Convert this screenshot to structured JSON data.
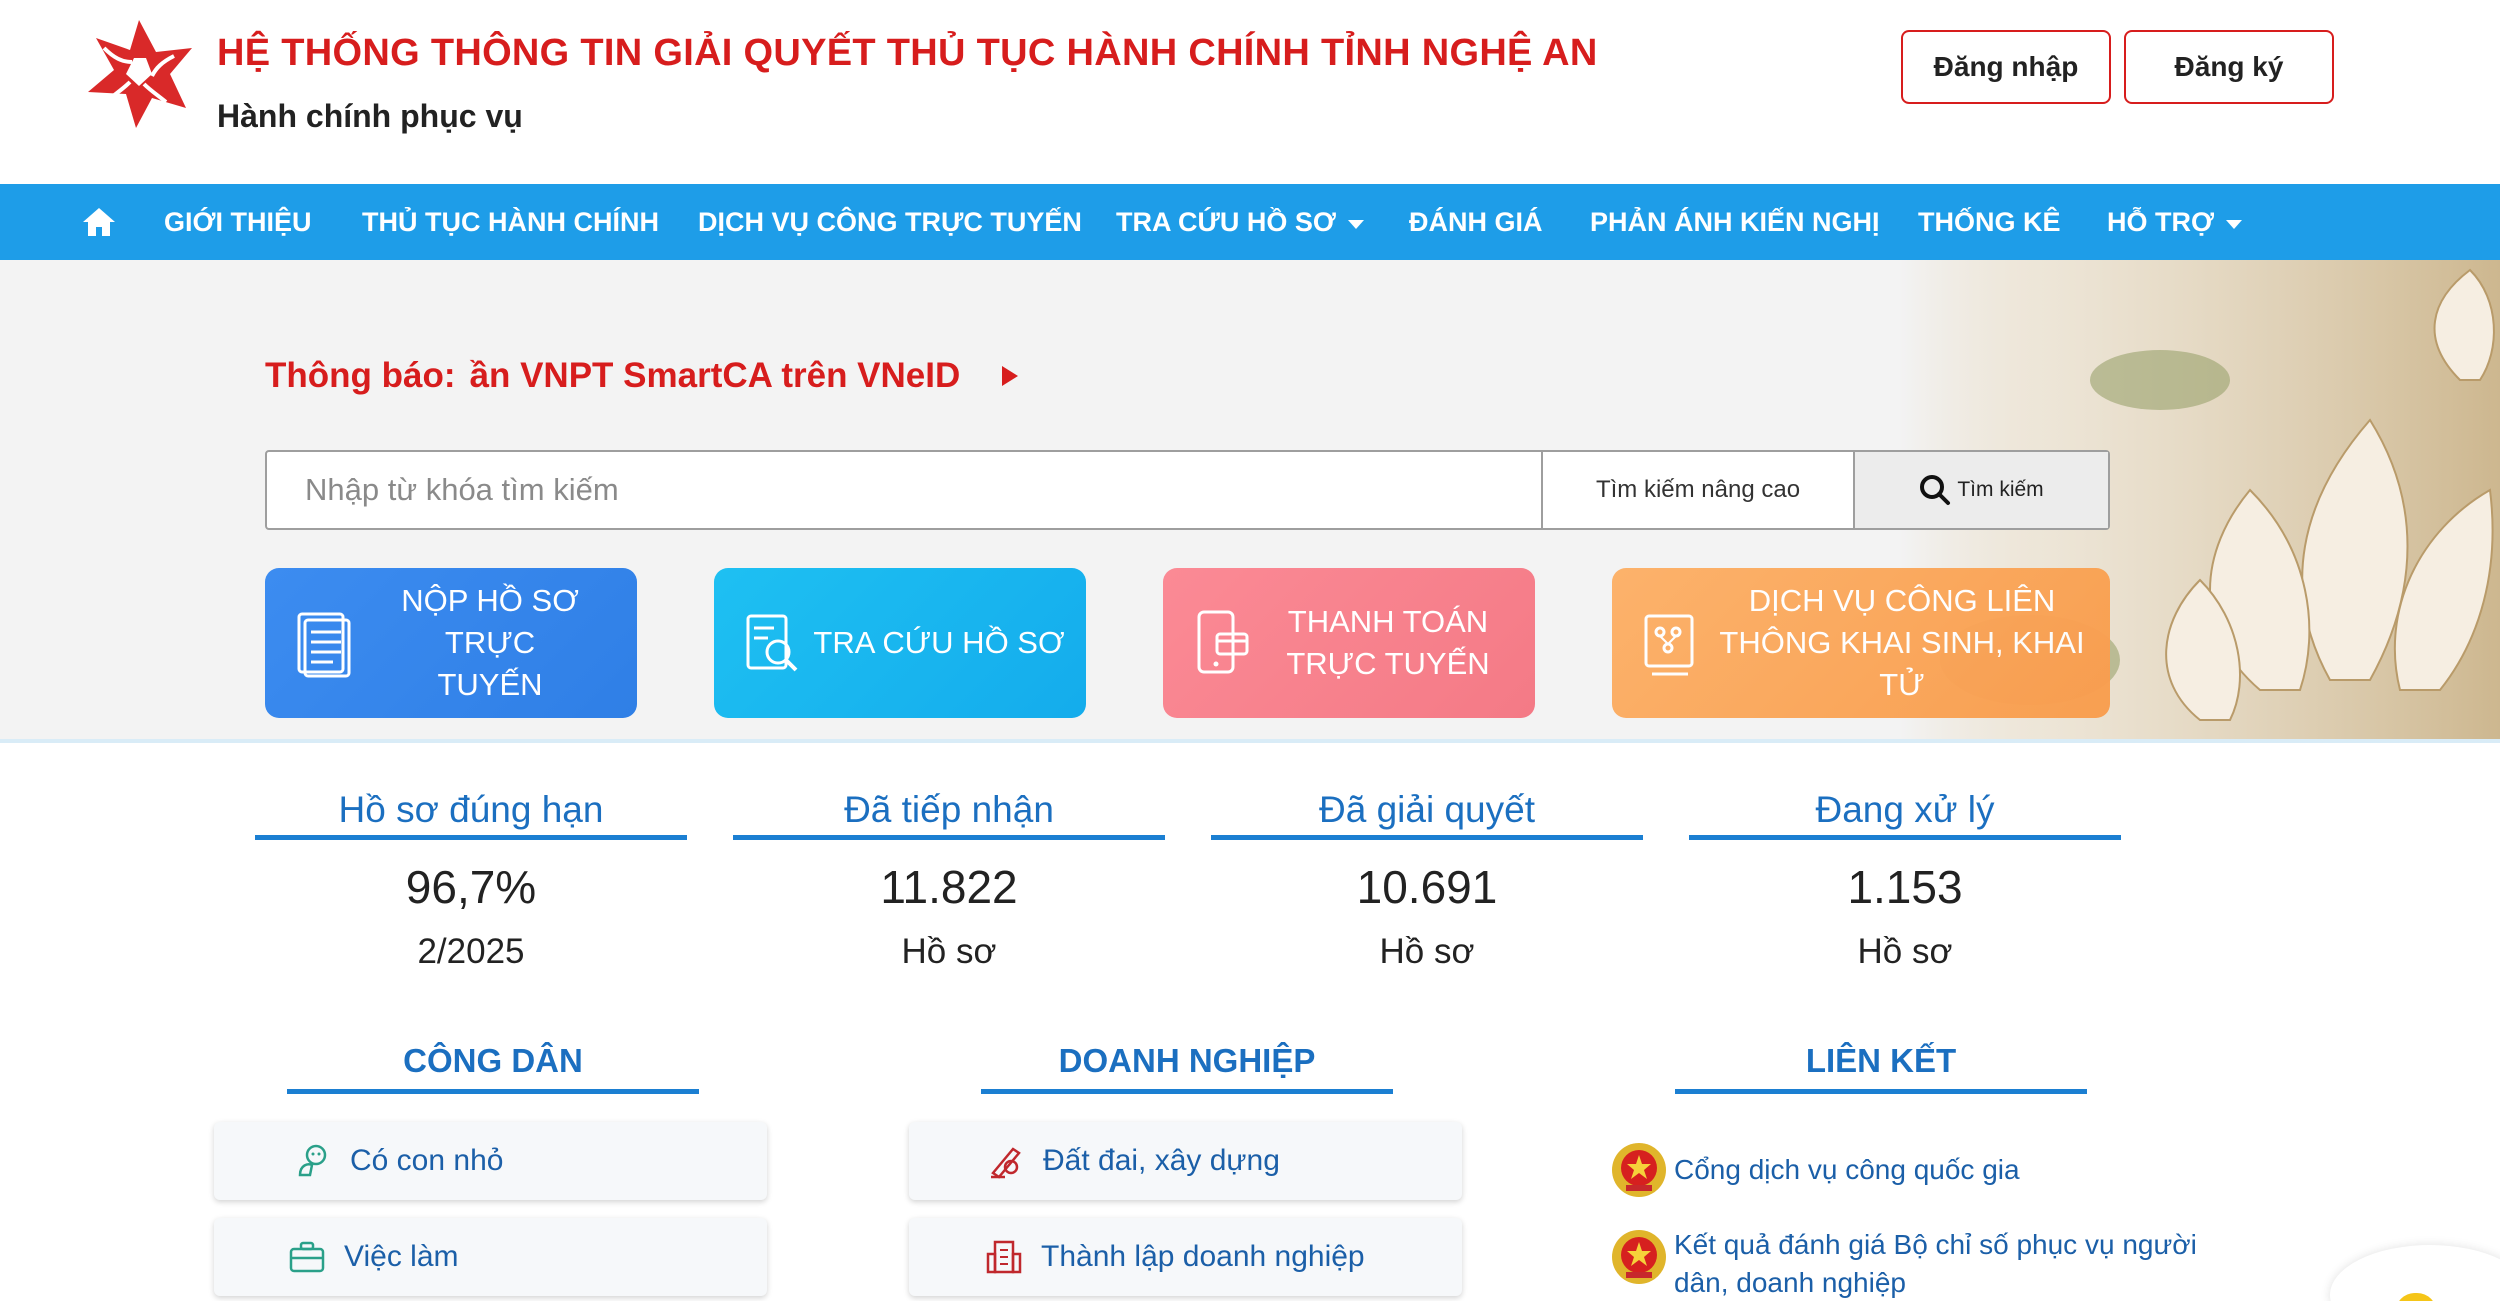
{
  "header": {
    "title": "HỆ THỐNG THÔNG TIN GIẢI QUYẾT THỦ TỤC HÀNH CHÍNH TỈNH NGHỆ AN",
    "subtitle": "Hành chính phục vụ",
    "login_label": "Đăng nhập",
    "register_label": "Đăng ký",
    "brand_color": "#d71d1d"
  },
  "nav": {
    "home_icon": "home-icon",
    "items": [
      {
        "label": "GIỚI THIỆU",
        "has_dropdown": false
      },
      {
        "label": "THỦ TỤC HÀNH CHÍNH",
        "has_dropdown": false
      },
      {
        "label": "DỊCH VỤ CÔNG TRỰC TUYẾN",
        "has_dropdown": false
      },
      {
        "label": "TRA CỨU HỒ SƠ",
        "has_dropdown": true
      },
      {
        "label": "ĐÁNH GIÁ",
        "has_dropdown": false
      },
      {
        "label": "PHẢN ÁNH KIẾN NGHỊ",
        "has_dropdown": false
      },
      {
        "label": "THỐNG KÊ",
        "has_dropdown": false
      },
      {
        "label": "HỖ TRỢ",
        "has_dropdown": true
      }
    ],
    "background": "#1e9de8"
  },
  "notice": {
    "label": "Thông báo:",
    "text": "ần VNPT SmartCA trên VNeID"
  },
  "search": {
    "placeholder": "Nhập từ khóa tìm kiếm",
    "value": "",
    "advanced_label": "Tìm kiếm nâng cao",
    "button_label": "Tìm kiếm"
  },
  "quick_actions": [
    {
      "line1": "NỘP HỒ SƠ TRỰC",
      "line2": "TUYẾN",
      "icon": "document-list-icon",
      "color": "#3c8cf0"
    },
    {
      "label": "TRA CỨU HỒ SƠ",
      "icon": "document-search-icon",
      "color": "#1ec0f2"
    },
    {
      "line1": "THANH TOÁN",
      "line2": "TRỰC TUYẾN",
      "icon": "mobile-payment-icon",
      "color": "#fb8a95"
    },
    {
      "line1": "DỊCH VỤ CÔNG LIÊN",
      "line2": "THÔNG KHAI SINH, KHAI TỬ",
      "icon": "interconnected-service-icon",
      "color": "#fdb067"
    }
  ],
  "stats": [
    {
      "title": "Hồ sơ đúng hạn",
      "value": "96,7%",
      "sub": "2/2025"
    },
    {
      "title": "Đã tiếp nhận",
      "value": "11.822",
      "sub": "Hồ sơ"
    },
    {
      "title": "Đã giải quyết",
      "value": "10.691",
      "sub": "Hồ sơ"
    },
    {
      "title": "Đang xử lý",
      "value": "1.153",
      "sub": "Hồ sơ"
    }
  ],
  "sections": {
    "citizen": {
      "title": "CÔNG DÂN",
      "items": [
        {
          "label": "Có con nhỏ",
          "icon": "baby-icon"
        },
        {
          "label": "Việc làm",
          "icon": "briefcase-icon"
        }
      ]
    },
    "business": {
      "title": "DOANH NGHIỆP",
      "items": [
        {
          "label": "Đất đai, xây dựng",
          "icon": "construction-icon"
        },
        {
          "label": "Thành lập doanh nghiệp",
          "icon": "building-icon"
        }
      ]
    },
    "links": {
      "title": "LIÊN KẾT",
      "items": [
        {
          "label": "Cổng dịch vụ công quốc gia",
          "icon": "national-emblem-icon"
        },
        {
          "line1": "Kết quả đánh giá Bộ chỉ số phục vụ người",
          "line2": "dân, doanh nghiệp",
          "icon": "national-emblem-icon"
        }
      ]
    }
  }
}
